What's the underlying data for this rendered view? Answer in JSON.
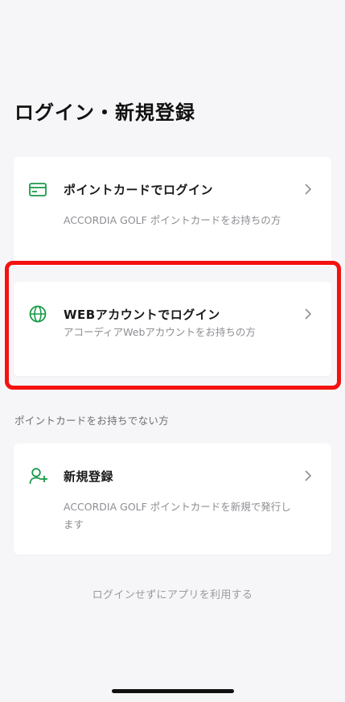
{
  "page": {
    "title": "ログイン・新規登録"
  },
  "options": {
    "point_card": {
      "title": "ポイントカードでログイン",
      "description": "ACCORDIA GOLF ポイントカードをお持ちの方",
      "icon": "card-icon"
    },
    "web_account": {
      "title": "WEBアカウントでログイン",
      "description": "アコーディアWebアカウントをお持ちの方",
      "icon": "globe-icon"
    }
  },
  "section": {
    "label": "ポイントカードをお持ちでない方"
  },
  "register": {
    "title": "新規登録",
    "description": "ACCORDIA GOLF ポイントカードを新規で発行します",
    "icon": "add-user-icon"
  },
  "skip": {
    "label": "ログインせずにアプリを利用する"
  },
  "colors": {
    "accent": "#1a9a4a",
    "highlight": "#f3120f",
    "background": "#f6f6f8"
  }
}
